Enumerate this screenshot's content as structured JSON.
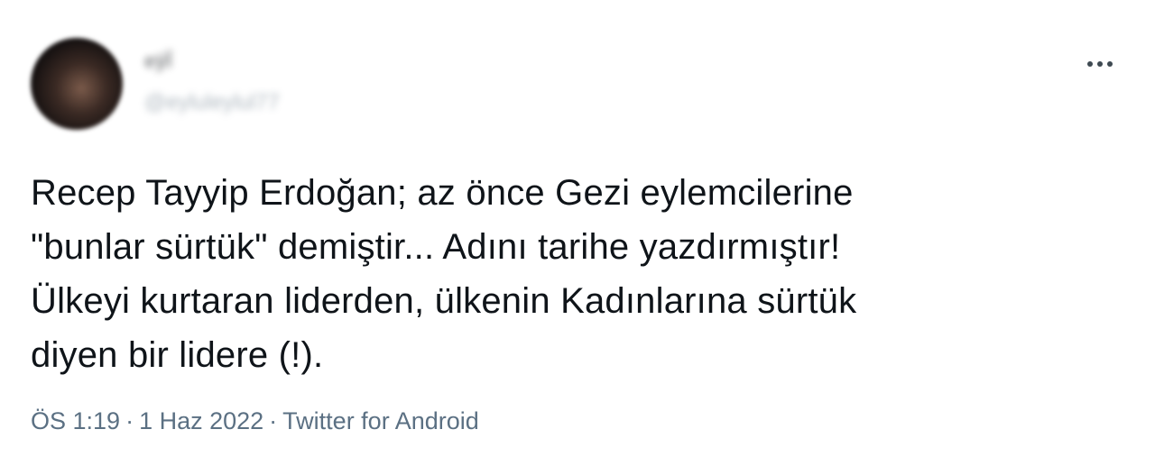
{
  "user": {
    "display_name": "eÿl̈",
    "handle": "@eyluleylul77"
  },
  "tweet": {
    "lines": [
      "Recep Tayyip Erdoğan; az önce Gezi eylemcilerine",
      "\"bunlar sürtük\" demiştir... Adını tarihe yazdırmıştır!",
      "Ülkeyi kurtaran liderden, ülkenin Kadınlarına sürtük",
      "diyen bir lidere (!)."
    ],
    "time": "ÖS 1:19",
    "date": "1 Haz 2022",
    "source": "Twitter for Android",
    "separator": "·"
  },
  "icons": {
    "more": "more-horizontal-icon"
  }
}
